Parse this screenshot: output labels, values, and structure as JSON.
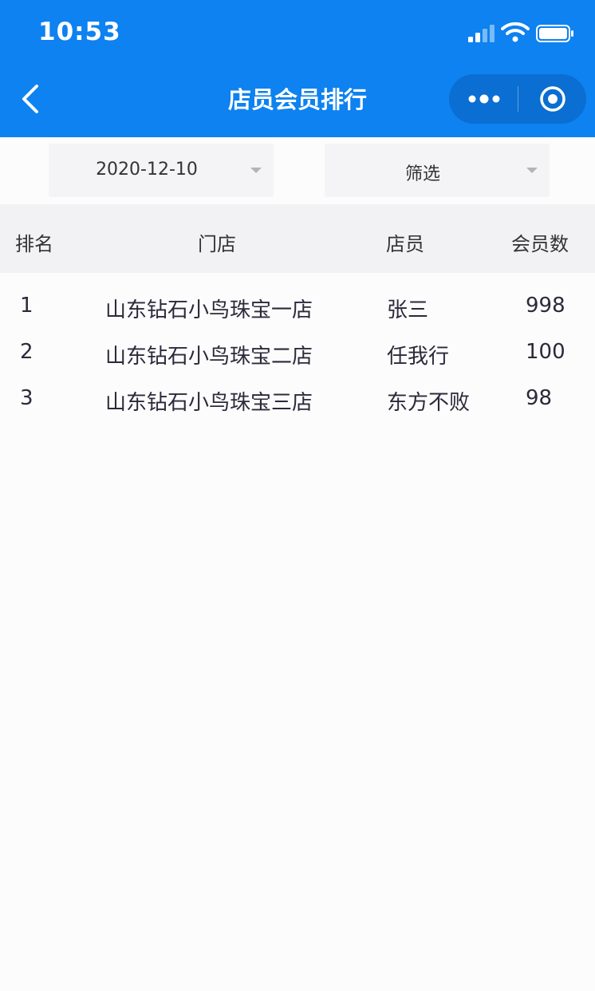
{
  "status_bar": {
    "time": "10:53"
  },
  "nav": {
    "title": "店员会员排行",
    "back_icon": "chevron-left-icon",
    "more_icon": "more-dots-icon",
    "close_icon": "target-circle-icon"
  },
  "colors": {
    "primary": "#0d82f0",
    "capsule": "#0a6ed2",
    "header_bg": "#f2f2f4",
    "filter_bg": "#f4f4f6"
  },
  "filters": {
    "date": "2020-12-10",
    "filter": "筛选"
  },
  "table": {
    "columns": {
      "rank": "排名",
      "store": "门店",
      "clerk": "店员",
      "count": "会员数"
    },
    "rows": [
      {
        "rank": "1",
        "store": "山东钻石小鸟珠宝一店",
        "clerk": "张三",
        "count": "998"
      },
      {
        "rank": "2",
        "store": "山东钻石小鸟珠宝二店",
        "clerk": "任我行",
        "count": "100"
      },
      {
        "rank": "3",
        "store": "山东钻石小鸟珠宝三店",
        "clerk": "东方不败",
        "count": "98"
      }
    ]
  }
}
